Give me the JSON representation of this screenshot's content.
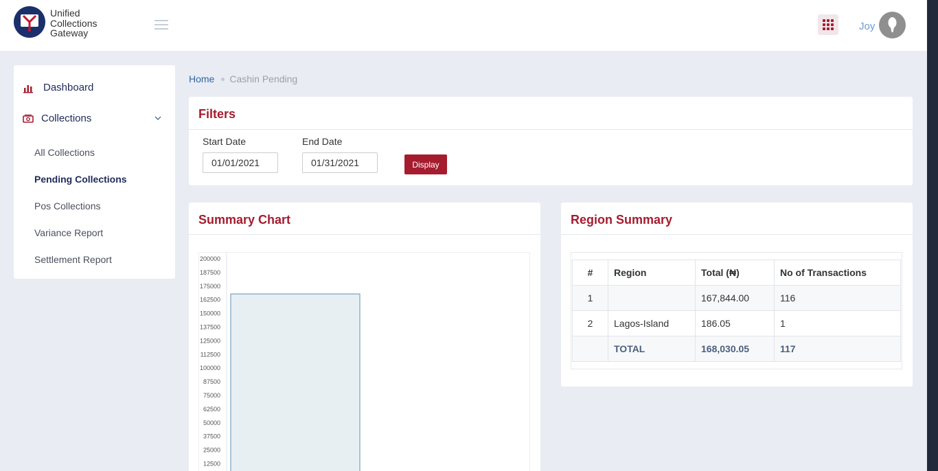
{
  "header": {
    "logo_lines": [
      "Unified",
      "Collections",
      "Gateway"
    ],
    "user_name": "Joy",
    "icons": {
      "menu": "hamburger-icon",
      "apps": "apps-grid-icon",
      "avatar": "user-avatar-icon"
    }
  },
  "sidebar": {
    "items": [
      {
        "label": "Dashboard",
        "icon": "bar-chart-icon"
      },
      {
        "label": "Collections",
        "icon": "money-icon",
        "expanded": true
      }
    ],
    "sub_items": [
      {
        "label": "All Collections"
      },
      {
        "label": "Pending Collections",
        "active": true
      },
      {
        "label": "Pos Collections"
      },
      {
        "label": "Variance Report"
      },
      {
        "label": "Settlement Report"
      }
    ]
  },
  "breadcrumb": {
    "home": "Home",
    "current": "Cashin Pending"
  },
  "filters": {
    "title": "Filters",
    "start_label": "Start Date",
    "start_value": "01/01/2021",
    "end_label": "End Date",
    "end_value": "01/31/2021",
    "button": "Display"
  },
  "summary_chart": {
    "title": "Summary Chart"
  },
  "chart_data": {
    "type": "bar",
    "categories": [
      ""
    ],
    "values": [
      167844
    ],
    "ylim": [
      0,
      200000
    ],
    "yticks": [
      12500,
      25000,
      37500,
      50000,
      62500,
      75000,
      87500,
      100000,
      112500,
      125000,
      137500,
      150000,
      162500,
      175000,
      187500,
      200000
    ],
    "bar_color": "#e8eff3",
    "bar_border": "#8eb3cc"
  },
  "region_summary": {
    "title": "Region Summary",
    "columns": [
      "#",
      "Region",
      "Total (₦)",
      "No of Transactions"
    ],
    "rows": [
      [
        "1",
        "",
        "167,844.00",
        "116"
      ],
      [
        "2",
        "Lagos-Island",
        "186.05",
        "1"
      ]
    ],
    "total": [
      "",
      "TOTAL",
      "168,030.05",
      "117"
    ]
  },
  "colors": {
    "accent": "#a51c2f",
    "navy": "#1e2a5a",
    "link": "#2f65a8",
    "background": "#e9ecf2"
  }
}
